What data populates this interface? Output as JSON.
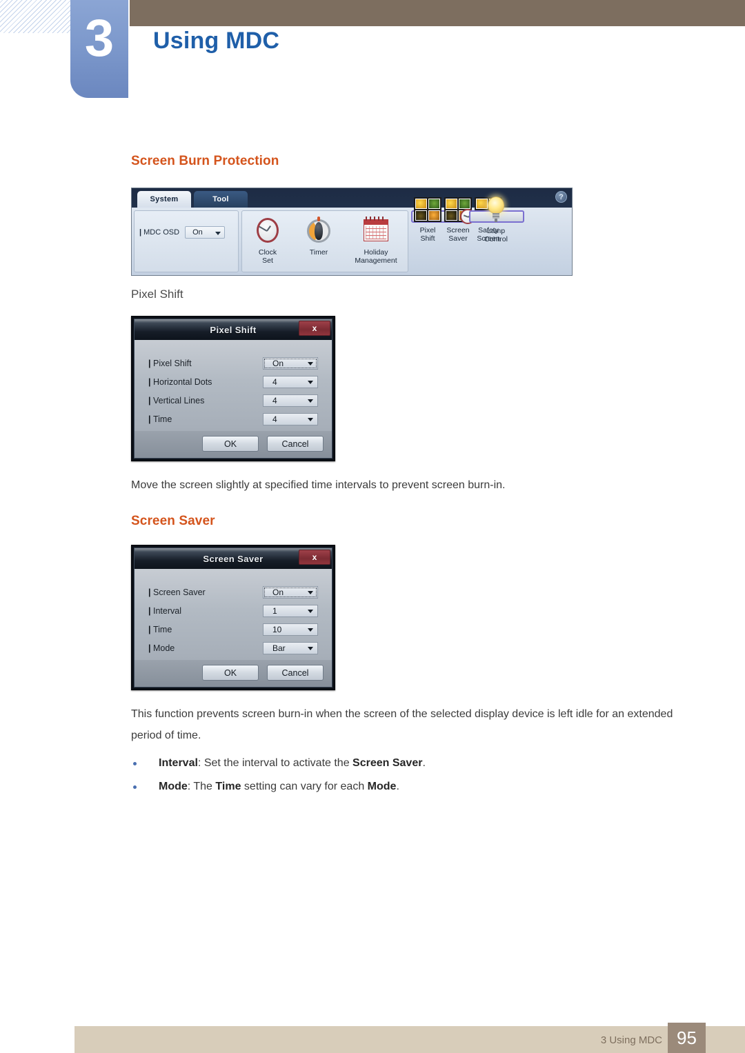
{
  "header": {
    "chapter_number": "3",
    "chapter_title": "Using MDC"
  },
  "sections": {
    "screen_burn_protection": "Screen Burn Protection",
    "pixel_shift_sub": "Pixel Shift",
    "screen_saver": "Screen Saver"
  },
  "mdc_toolbar": {
    "tabs": [
      {
        "label": "System",
        "active": true
      },
      {
        "label": "Tool",
        "active": false
      }
    ],
    "help_icon": "?",
    "osd": {
      "label": "MDC OSD",
      "value": "On"
    },
    "tools": [
      {
        "name": "clock-set",
        "label_line1": "Clock",
        "label_line2": "Set"
      },
      {
        "name": "timer",
        "label_line1": "Timer",
        "label_line2": ""
      },
      {
        "name": "holiday-management",
        "label_line1": "Holiday",
        "label_line2": "Management"
      },
      {
        "name": "pixel-shift",
        "label_line1": "Pixel",
        "label_line2": "Shift"
      },
      {
        "name": "screen-saver",
        "label_line1": "Screen",
        "label_line2": "Saver"
      },
      {
        "name": "safety-screen",
        "label_line1": "Safety",
        "label_line2": "Screen"
      },
      {
        "name": "lamp-control",
        "label_line1": "Lamp",
        "label_line2": "Control"
      }
    ],
    "selection_highlight_color": "#7a6fd0"
  },
  "pixel_shift_dialog": {
    "title": "Pixel Shift",
    "close_label": "x",
    "rows": [
      {
        "label": "Pixel Shift",
        "value": "On"
      },
      {
        "label": "Horizontal Dots",
        "value": "4"
      },
      {
        "label": "Vertical Lines",
        "value": "4"
      },
      {
        "label": "Time",
        "value": "4"
      }
    ],
    "ok": "OK",
    "cancel": "Cancel"
  },
  "pixel_shift_caption": "Move the screen slightly at specified time intervals to prevent screen burn-in.",
  "screen_saver_dialog": {
    "title": "Screen Saver",
    "close_label": "x",
    "rows": [
      {
        "label": "Screen Saver",
        "value": "On"
      },
      {
        "label": "Interval",
        "value": "1"
      },
      {
        "label": "Time",
        "value": "10"
      },
      {
        "label": "Mode",
        "value": "Bar"
      }
    ],
    "ok": "OK",
    "cancel": "Cancel"
  },
  "screen_saver_paragraph": "This function prevents screen burn-in when the screen of the selected display device is left idle for an extended period of time.",
  "bullets": [
    {
      "lead": "Interval",
      "mid": ": Set the interval to activate the ",
      "strong": "Screen Saver",
      "tail": "."
    },
    {
      "lead": "Mode",
      "mid": ": The ",
      "strong": "Time",
      "tail2": " setting can vary for each ",
      "strong2": "Mode",
      "tail": "."
    }
  ],
  "footer": {
    "label": "3 Using MDC",
    "page": "95"
  },
  "colors": {
    "accent_orange": "#d4541c",
    "chapter_blue": "#1f5fa9",
    "header_brown": "#7d6e5f",
    "footer_band": "#d8cdba",
    "footer_page_box": "#9b8a7a"
  }
}
